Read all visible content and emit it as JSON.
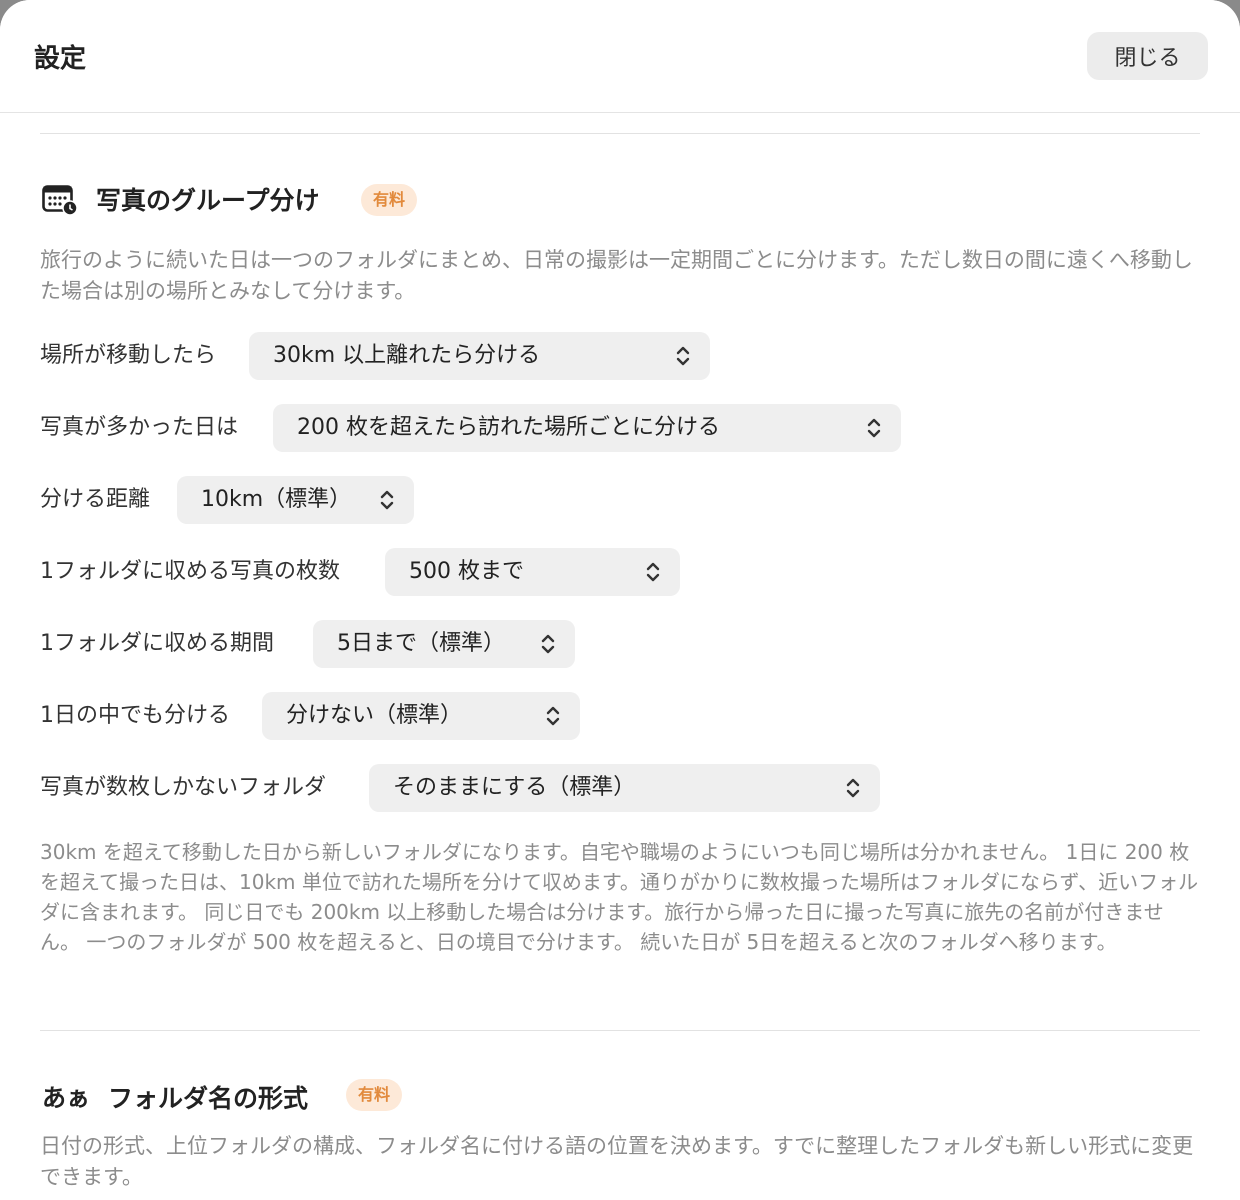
{
  "header": {
    "title": "設定",
    "close_label": "閉じる"
  },
  "section1": {
    "icon": "calendar-clock-icon",
    "title": "写真のグループ分け",
    "badge": "有料",
    "description": "旅行のように続いた日は一つのフォルダにまとめ、日常の撮影は一定期間ごとに分けます。ただし数日の間に遠くへ移動した場合は別の場所とみなして分けます。",
    "rows": [
      {
        "label": "場所が移動したら",
        "value": "30km 以上離れたら分ける"
      },
      {
        "label": "写真が多かった日は",
        "value": "200 枚を超えたら訪れた場所ごとに分ける"
      },
      {
        "label": "分ける距離",
        "value": "10km（標準）"
      },
      {
        "label": "1フォルダに収める写真の枚数",
        "value": "500 枚まで"
      },
      {
        "label": "1フォルダに収める期間",
        "value": "5日まで（標準）"
      },
      {
        "label": "1日の中でも分ける",
        "value": "分けない（標準）"
      },
      {
        "label": "写真が数枚しかないフォルダ",
        "value": "そのままにする（標準）"
      }
    ],
    "note": "30km を超えて移動した日から新しいフォルダになります。自宅や職場のようにいつも同じ場所は分かれません。 1日に 200 枚を超えて撮った日は、10km 単位で訪れた場所を分けて収めます。通りがかりに数枚撮った場所はフォルダにならず、近いフォルダに含まれます。 同じ日でも 200km 以上移動した場合は分けます。旅行から帰った日に撮った写真に旅先の名前が付きません。 一つのフォルダが 500 枚を超えると、日の境目で分けます。 続いた日が 5日を超えると次のフォルダへ移ります。"
  },
  "section2": {
    "icon_text": "あぁ",
    "title": "フォルダ名の形式",
    "badge": "有料",
    "description": "日付の形式、上位フォルダの構成、フォルダ名に付ける語の位置を決めます。すでに整理したフォルダも新しい形式に変更できます。"
  }
}
